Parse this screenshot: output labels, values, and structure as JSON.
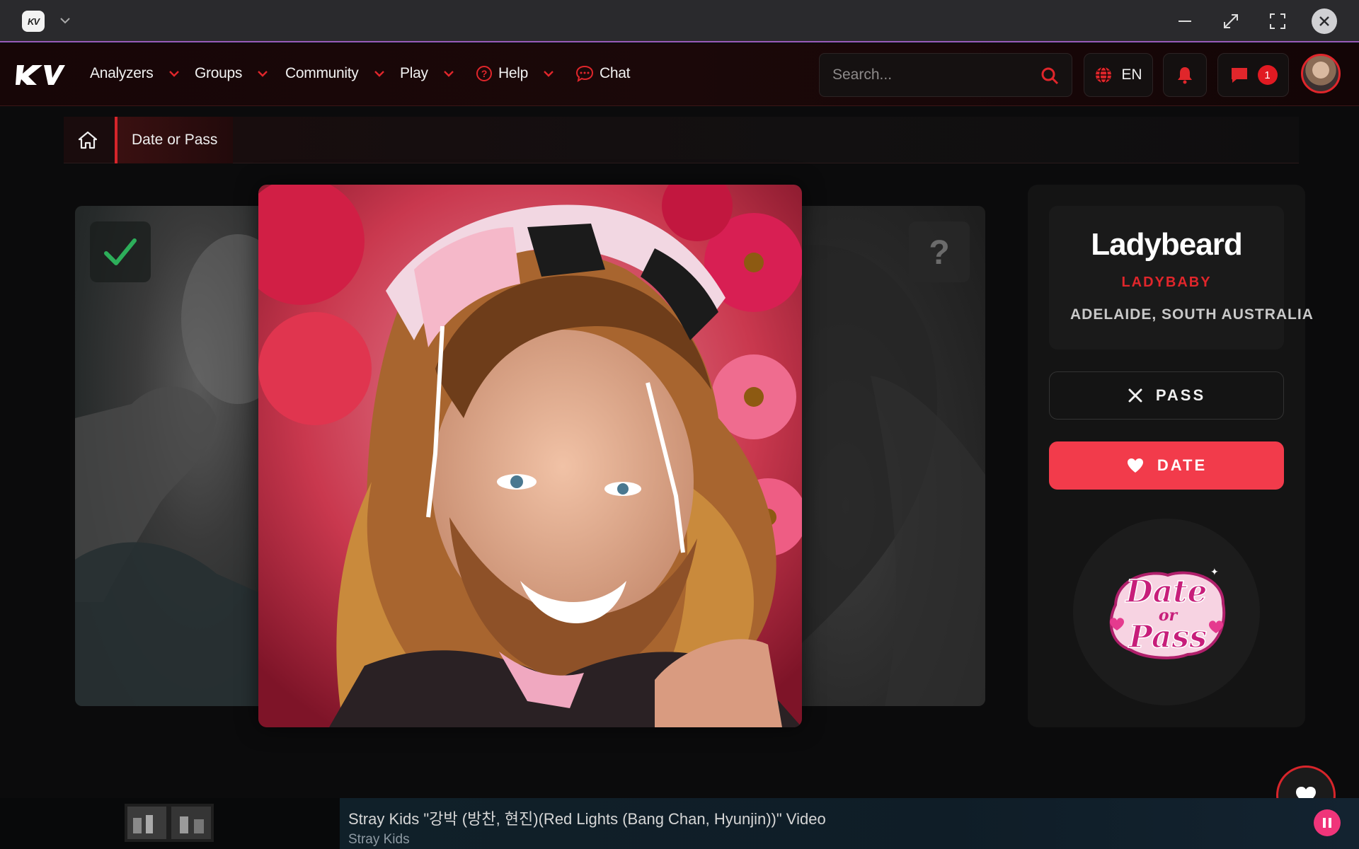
{
  "window": {
    "logo_text": "KV"
  },
  "nav": {
    "items": [
      {
        "label": "Analyzers"
      },
      {
        "label": "Groups"
      },
      {
        "label": "Community"
      },
      {
        "label": "Play"
      },
      {
        "label": "Help"
      },
      {
        "label": "Chat"
      }
    ],
    "search_placeholder": "Search...",
    "language": "EN",
    "message_count": "1",
    "accent_color": "#e0262b"
  },
  "breadcrumb": {
    "current": "Date or Pass"
  },
  "profile": {
    "name": "Ladybeard",
    "group": "LADYBABY",
    "location": "ADELAIDE, SOUTH AUSTRALIA"
  },
  "actions": {
    "pass_label": "PASS",
    "date_label": "DATE",
    "date_color": "#f23b4b"
  },
  "logo": {
    "line1": "Date",
    "line2": "or",
    "line3": "Pass"
  },
  "music": {
    "song_title": "Stray Kids \"강박 (방찬, 현진)(Red Lights (Bang Chan, Hyunjin))\" Video",
    "artist": "Stray Kids",
    "accent_color": "#f0357a"
  }
}
